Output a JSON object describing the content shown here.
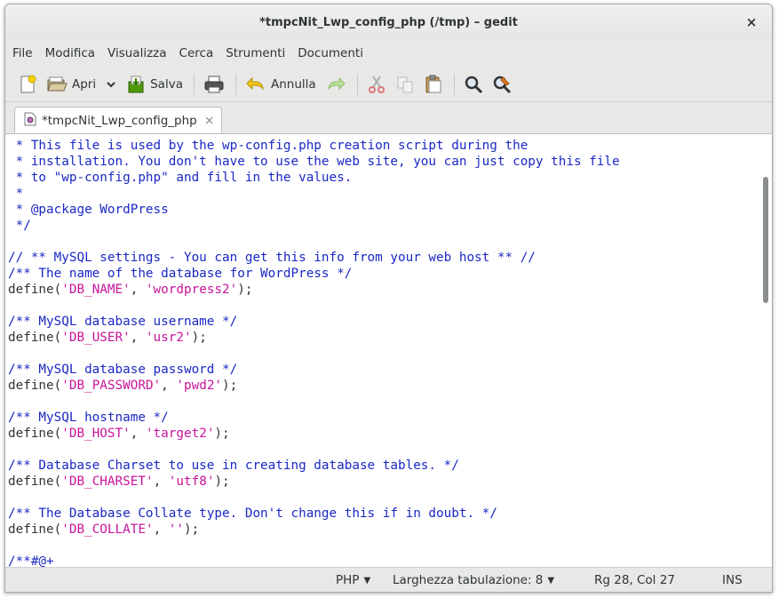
{
  "window": {
    "title": "*tmpcNit_Lwp_config_php (/tmp) – gedit",
    "close_glyph": "×"
  },
  "menu": [
    "File",
    "Modifica",
    "Visualizza",
    "Cerca",
    "Strumenti",
    "Documenti"
  ],
  "toolbar": {
    "open_label": "Apri",
    "save_label": "Salva",
    "undo_label": "Annulla",
    "icons": [
      "new-document-icon",
      "open-folder-icon",
      "chevron-down-icon",
      "save-icon",
      "print-icon",
      "undo-icon",
      "redo-icon",
      "cut-icon",
      "copy-icon",
      "paste-icon",
      "search-icon",
      "replace-icon"
    ]
  },
  "tab": {
    "label": "*tmpcNit_Lwp_config_php",
    "close_glyph": "×"
  },
  "code_lines": [
    [
      {
        "t": " * This file is used by the wp-config.php creation script during the",
        "c": "comment"
      }
    ],
    [
      {
        "t": " * installation. You don't have to use the web site, you can just copy this file",
        "c": "comment"
      }
    ],
    [
      {
        "t": " * to \"wp-config.php\" and fill in the values.",
        "c": "comment"
      }
    ],
    [
      {
        "t": " *",
        "c": "comment"
      }
    ],
    [
      {
        "t": " * @package WordPress",
        "c": "comment"
      }
    ],
    [
      {
        "t": " */",
        "c": "comment"
      }
    ],
    [
      {
        "t": "",
        "c": "plain"
      }
    ],
    [
      {
        "t": "// ** MySQL settings - You can get this info from your web host ** //",
        "c": "comment"
      }
    ],
    [
      {
        "t": "/** The name of the database for WordPress */",
        "c": "comment"
      }
    ],
    [
      {
        "t": "define(",
        "c": "plain"
      },
      {
        "t": "'DB_NAME'",
        "c": "str"
      },
      {
        "t": ", ",
        "c": "plain"
      },
      {
        "t": "'wordpress2'",
        "c": "str"
      },
      {
        "t": ");",
        "c": "plain"
      }
    ],
    [
      {
        "t": "",
        "c": "plain"
      }
    ],
    [
      {
        "t": "/** MySQL database username */",
        "c": "comment"
      }
    ],
    [
      {
        "t": "define(",
        "c": "plain"
      },
      {
        "t": "'DB_USER'",
        "c": "str"
      },
      {
        "t": ", ",
        "c": "plain"
      },
      {
        "t": "'usr2'",
        "c": "str"
      },
      {
        "t": ");",
        "c": "plain"
      }
    ],
    [
      {
        "t": "",
        "c": "plain"
      }
    ],
    [
      {
        "t": "/** MySQL database password */",
        "c": "comment"
      }
    ],
    [
      {
        "t": "define(",
        "c": "plain"
      },
      {
        "t": "'DB_PASSWORD'",
        "c": "str"
      },
      {
        "t": ", ",
        "c": "plain"
      },
      {
        "t": "'pwd2'",
        "c": "str"
      },
      {
        "t": ");",
        "c": "plain"
      }
    ],
    [
      {
        "t": "",
        "c": "plain"
      }
    ],
    [
      {
        "t": "/** MySQL hostname */",
        "c": "comment"
      }
    ],
    [
      {
        "t": "define(",
        "c": "plain"
      },
      {
        "t": "'DB_HOST'",
        "c": "str"
      },
      {
        "t": ", ",
        "c": "plain"
      },
      {
        "t": "'target2'",
        "c": "str"
      },
      {
        "t": ");",
        "c": "plain"
      }
    ],
    [
      {
        "t": "",
        "c": "plain"
      }
    ],
    [
      {
        "t": "/** Database Charset to use in creating database tables. */",
        "c": "comment"
      }
    ],
    [
      {
        "t": "define(",
        "c": "plain"
      },
      {
        "t": "'DB_CHARSET'",
        "c": "str"
      },
      {
        "t": ", ",
        "c": "plain"
      },
      {
        "t": "'utf8'",
        "c": "str"
      },
      {
        "t": ");",
        "c": "plain"
      }
    ],
    [
      {
        "t": "",
        "c": "plain"
      }
    ],
    [
      {
        "t": "/** The Database Collate type. Don't change this if in doubt. */",
        "c": "comment"
      }
    ],
    [
      {
        "t": "define(",
        "c": "plain"
      },
      {
        "t": "'DB_COLLATE'",
        "c": "str"
      },
      {
        "t": ", ",
        "c": "plain"
      },
      {
        "t": "''",
        "c": "str"
      },
      {
        "t": ");",
        "c": "plain"
      }
    ],
    [
      {
        "t": "",
        "c": "plain"
      }
    ],
    [
      {
        "t": "/**#@+",
        "c": "comment"
      }
    ]
  ],
  "statusbar": {
    "language": "PHP",
    "tab_width": "Larghezza tabulazione: 8",
    "position": "Rg 28, Col 27",
    "mode": "INS"
  },
  "colors": {
    "comment": "#1a28c4",
    "string": "#c8149a",
    "plain": "#2e3436"
  }
}
